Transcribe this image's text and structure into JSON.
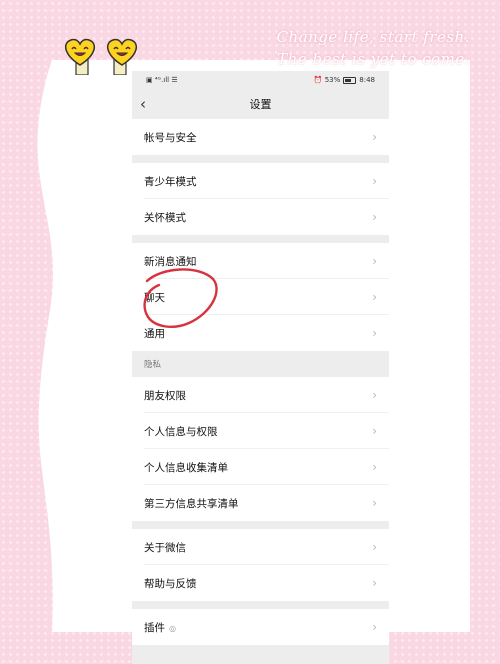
{
  "decoration": {
    "tagline_line1": "Change life, start fresh.",
    "tagline_line2": "The best is yet to come.",
    "background_color": "#f9d7e3",
    "annotation_color": "#d7333f"
  },
  "status_bar": {
    "left_icons": "▣ ⁴ᴳ.ıll ☰",
    "right_text": "⏰ 53%",
    "time": "8:48"
  },
  "nav": {
    "back_icon": "‹",
    "title": "设置"
  },
  "groups": [
    {
      "items": [
        {
          "label": "帐号与安全"
        }
      ]
    },
    {
      "items": [
        {
          "label": "青少年模式"
        },
        {
          "label": "关怀模式"
        }
      ]
    },
    {
      "items": [
        {
          "label": "新消息通知"
        },
        {
          "label": "聊天"
        },
        {
          "label": "通用"
        }
      ]
    },
    {
      "header": "隐私",
      "items": [
        {
          "label": "朋友权限"
        },
        {
          "label": "个人信息与权限"
        },
        {
          "label": "个人信息收集清单"
        },
        {
          "label": "第三方信息共享清单"
        }
      ]
    },
    {
      "items": [
        {
          "label": "关于微信"
        },
        {
          "label": "帮助与反馈"
        }
      ]
    },
    {
      "items": [
        {
          "label": "插件",
          "icon": "location-pin-icon"
        }
      ]
    }
  ],
  "chevron": "›"
}
